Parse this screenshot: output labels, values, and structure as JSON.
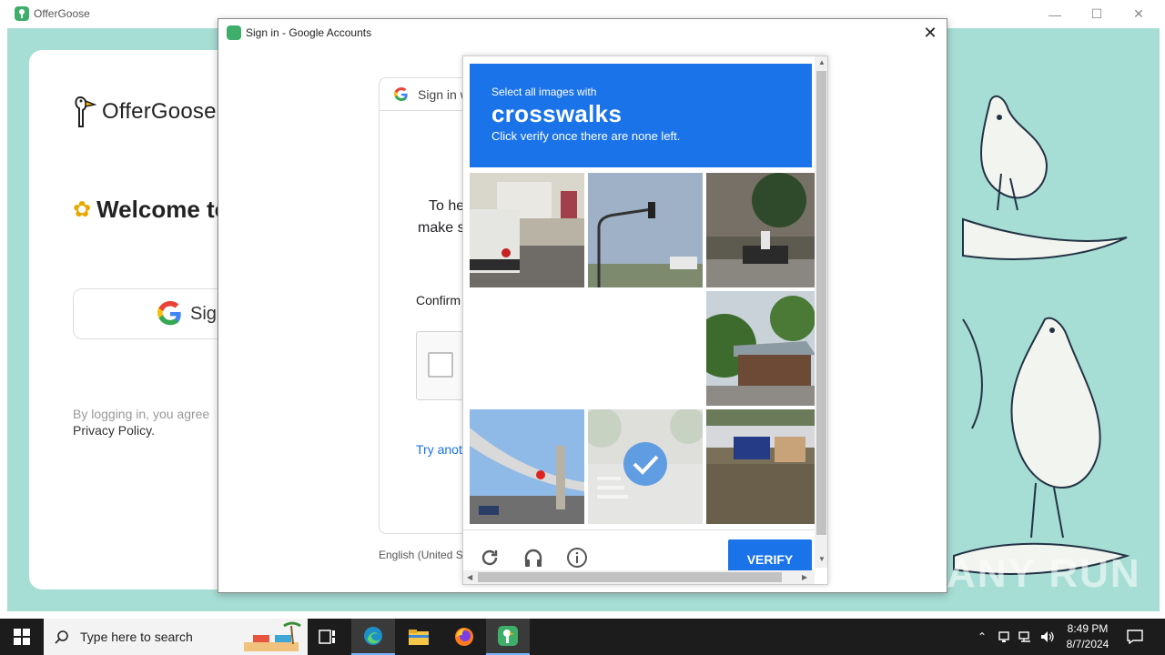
{
  "app": {
    "title": "OfferGoose",
    "brand_name": "OfferGoose",
    "welcome": "Welcome to",
    "google_button": "Sign",
    "legal_line": "By logging in, you agree",
    "privacy_link": "Privacy Policy."
  },
  "dialog": {
    "title": "Sign in - Google Accounts",
    "header_text": "Sign in w",
    "line1": "To he",
    "line2": "make s",
    "confirm": "Confirm",
    "try_another": "Try anot",
    "language": "English (United S"
  },
  "captcha": {
    "intro": "Select all images with",
    "target": "crosswalks",
    "instruction": "Click verify once there are none left.",
    "verify_label": "VERIFY",
    "tiles": [
      {
        "scene": "truck-street",
        "selected": false,
        "loading": false
      },
      {
        "scene": "traffic-light",
        "selected": false,
        "loading": false
      },
      {
        "scene": "motorbike-wall",
        "selected": false,
        "loading": false
      },
      {
        "scene": "blank",
        "selected": false,
        "loading": true
      },
      {
        "scene": "blank",
        "selected": false,
        "loading": true
      },
      {
        "scene": "house-trees",
        "selected": false,
        "loading": false
      },
      {
        "scene": "overpass-road",
        "selected": false,
        "loading": false
      },
      {
        "scene": "crosswalk-street",
        "selected": true,
        "loading": false
      },
      {
        "scene": "motorbikes-lot",
        "selected": false,
        "loading": false
      }
    ]
  },
  "taskbar": {
    "search_placeholder": "Type here to search",
    "time": "8:49 PM",
    "date": "8/7/2024"
  },
  "watermark": "ANY RUN"
}
